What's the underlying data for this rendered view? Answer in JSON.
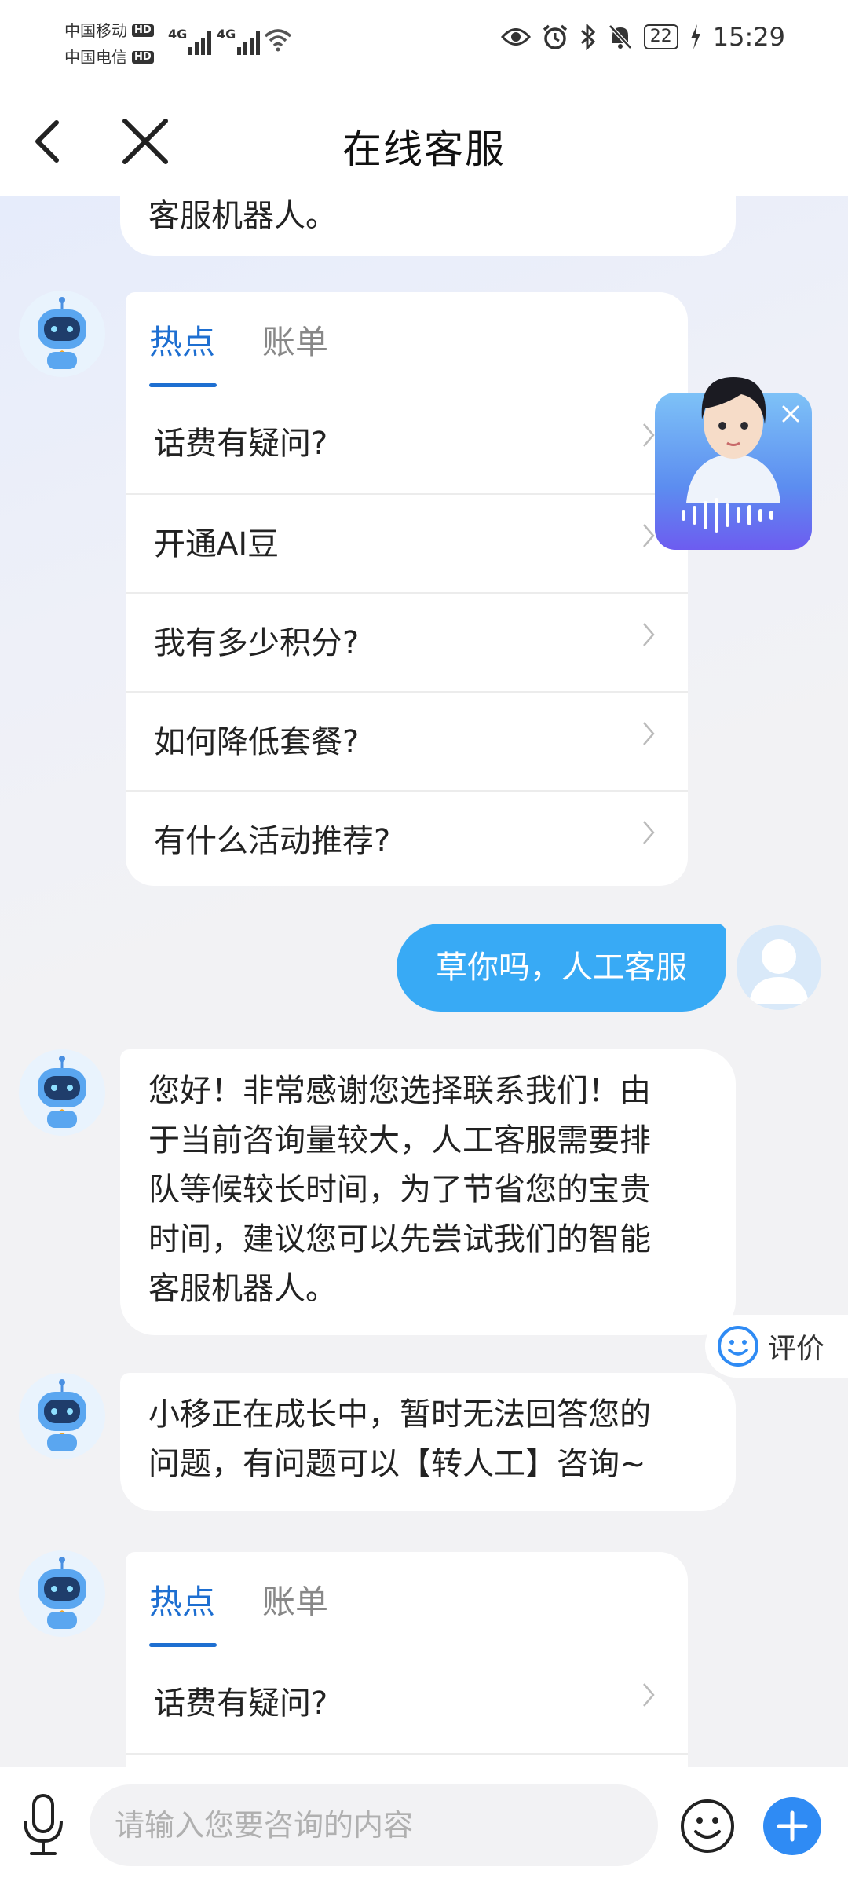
{
  "status_bar": {
    "carrier_1": "中国移动",
    "carrier_2": "中国电信",
    "hd": "HD",
    "net_1": "4G",
    "net_2": "4G",
    "battery": "22",
    "time": "15:29"
  },
  "header": {
    "title": "在线客服"
  },
  "chat": {
    "top_partial_text": "客服机器人。",
    "menu_1": {
      "tabs": [
        "热点",
        "账单"
      ],
      "items": [
        "话费有疑问?",
        "开通AI豆",
        "我有多少积分?",
        "如何降低套餐?",
        "有什么活动推荐?"
      ]
    },
    "user_message": "草你吗，人工客服",
    "bot_reply_1": [
      "您好！非常感谢您选择联系我们！由",
      "于当前咨询量较大，人工客服需要排",
      "队等候较长时间，为了节省您的宝贵",
      "时间，建议您可以先尝试我们的智能",
      "客服机器人。"
    ],
    "rate_label": "评价",
    "bot_reply_2": [
      "小移正在成长中，暂时无法回答您的",
      "问题，有问题可以【转人工】咨询~"
    ],
    "menu_2": {
      "tabs": [
        "热点",
        "账单"
      ],
      "items": [
        "话费有疑问?"
      ]
    }
  },
  "input": {
    "placeholder": "请输入您要咨询的内容"
  },
  "colors": {
    "accent": "#1e6fd1",
    "user_bubble": "#38aaf5",
    "plus_button": "#2f8bf4"
  }
}
